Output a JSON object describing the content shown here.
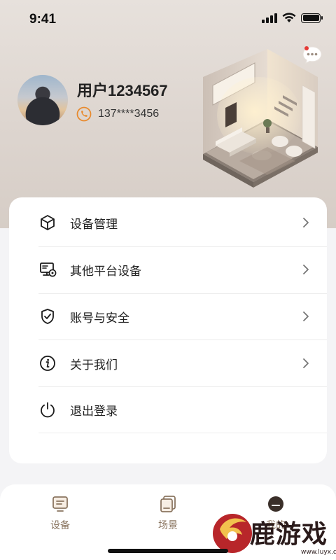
{
  "status_bar": {
    "time": "9:41",
    "battery_level": 1.0
  },
  "header": {
    "message_icon": "chat-bubble-icon",
    "has_unread": true,
    "username": "用户1234567",
    "phone": "137****3456",
    "phone_icon": "phone-icon"
  },
  "menu": {
    "items": [
      {
        "label": "设备管理",
        "icon": "cube-icon"
      },
      {
        "label": "其他平台设备",
        "icon": "monitor-settings-icon"
      },
      {
        "label": "账号与安全",
        "icon": "shield-check-icon"
      },
      {
        "label": "关于我们",
        "icon": "info-icon"
      },
      {
        "label": "退出登录",
        "icon": "power-icon"
      }
    ]
  },
  "tabbar": {
    "tabs": [
      {
        "label": "设备",
        "icon": "device-icon"
      },
      {
        "label": "场景",
        "icon": "scene-icon"
      },
      {
        "label": "我的",
        "icon": "profile-icon"
      }
    ]
  },
  "watermark": {
    "text": "鹿游戏",
    "sub": "www.luyx.cn"
  },
  "colors": {
    "accent": "#e88a2e",
    "tab_text": "#8a7560",
    "hero_bg": "#e2dbd5"
  }
}
